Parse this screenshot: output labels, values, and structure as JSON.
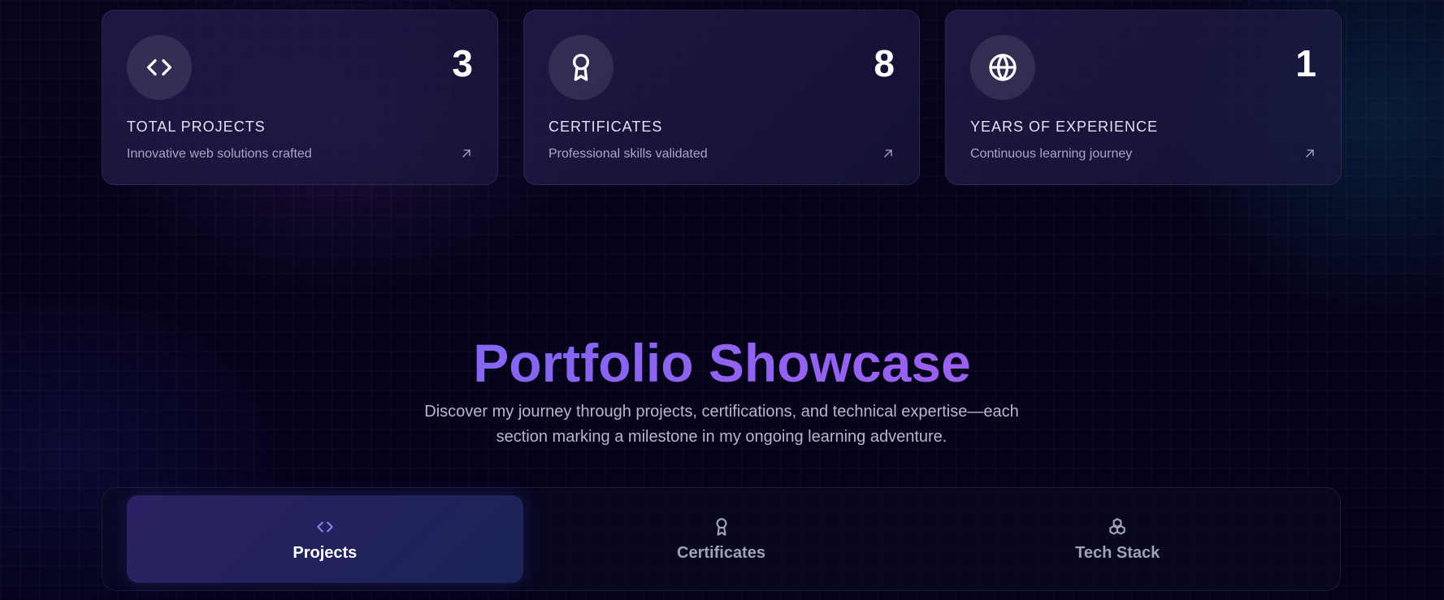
{
  "colors": {
    "background": "#05031a",
    "card": "#221c4a",
    "accent_start": "#6b6cf5",
    "accent_end": "#b25af0",
    "active_tab": "#2b2262"
  },
  "stats": [
    {
      "icon": "code-icon",
      "value": "3",
      "title": "TOTAL PROJECTS",
      "description": "Innovative web solutions crafted"
    },
    {
      "icon": "award-icon",
      "value": "8",
      "title": "CERTIFICATES",
      "description": "Professional skills validated"
    },
    {
      "icon": "globe-icon",
      "value": "1",
      "title": "YEARS OF EXPERIENCE",
      "description": "Continuous learning journey"
    }
  ],
  "showcase": {
    "title": "Portfolio Showcase",
    "subtitle_line1": "Discover my journey through projects, certifications, and technical expertise—each",
    "subtitle_line2": "section marking a milestone in my ongoing learning adventure."
  },
  "tabs": [
    {
      "label": "Projects",
      "icon": "code-icon",
      "active": true
    },
    {
      "label": "Certificates",
      "icon": "award-icon",
      "active": false
    },
    {
      "label": "Tech Stack",
      "icon": "boxes-icon",
      "active": false
    }
  ]
}
